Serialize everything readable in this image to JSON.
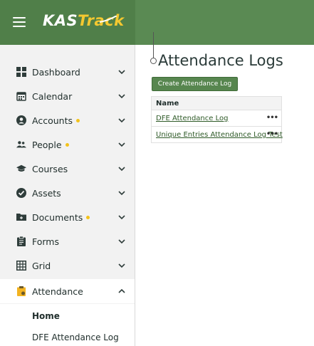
{
  "header": {
    "logo_prefix": "KAS",
    "logo_suffix": "Track",
    "menu_icon": "hamburger-menu-icon"
  },
  "sidebar": {
    "items": [
      {
        "label": "Dashboard",
        "icon": "dashboard-icon",
        "dot": false,
        "expanded": false
      },
      {
        "label": "Calendar",
        "icon": "calendar-icon",
        "dot": false,
        "expanded": false
      },
      {
        "label": "Accounts",
        "icon": "account-icon",
        "dot": true,
        "expanded": false
      },
      {
        "label": "People",
        "icon": "people-icon",
        "dot": true,
        "expanded": false
      },
      {
        "label": "Courses",
        "icon": "graduation-cap-icon",
        "dot": false,
        "expanded": false
      },
      {
        "label": "Assets",
        "icon": "check-circle-icon",
        "dot": false,
        "expanded": false
      },
      {
        "label": "Documents",
        "icon": "folder-icon",
        "dot": true,
        "expanded": false
      },
      {
        "label": "Forms",
        "icon": "form-icon",
        "dot": false,
        "expanded": false
      },
      {
        "label": "Grid",
        "icon": "grid-icon",
        "dot": false,
        "expanded": false
      },
      {
        "label": "Attendance",
        "icon": "clipboard-icon",
        "dot": false,
        "expanded": true
      }
    ],
    "sub_items": [
      {
        "label": "Home",
        "bold": true
      },
      {
        "label": "DFE Attendance Log",
        "bold": false
      }
    ],
    "dot_color": "#f3c21a"
  },
  "main": {
    "title": "Attendance Logs",
    "create_button": "Create Attendance Log",
    "table": {
      "header": "Name",
      "rows": [
        {
          "name": "DFE Attendance Log",
          "more": "•••"
        },
        {
          "name": "Unique Entries Attendance Log Test",
          "more": "•••"
        }
      ]
    }
  },
  "colors": {
    "accent": "#5a8a53",
    "sidebar_bg": "#f2f2f2",
    "link": "#2e5a27"
  }
}
